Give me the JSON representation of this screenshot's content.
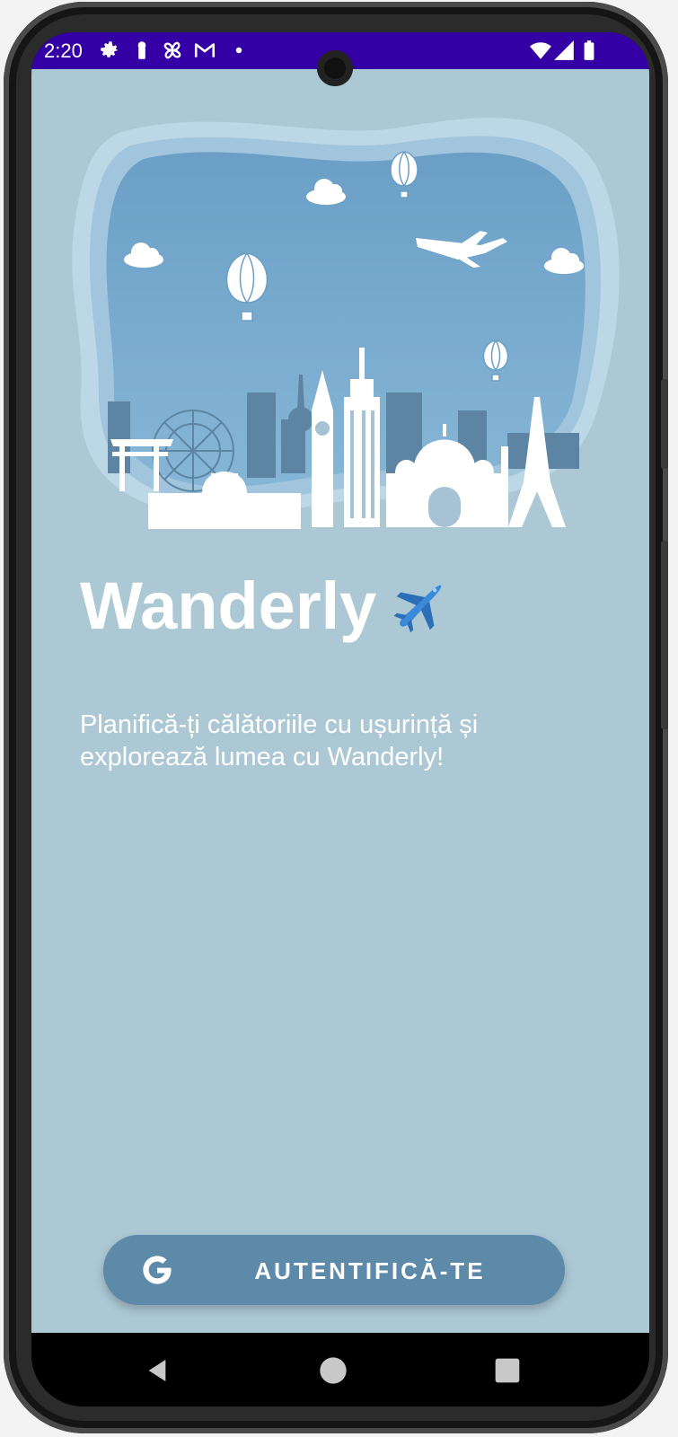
{
  "status_bar": {
    "time": "2:20",
    "left_icons": [
      "settings-icon",
      "keyhole-icon",
      "pinwheel-icon",
      "gmail-icon",
      "dot-icon"
    ],
    "right_icons": [
      "wifi-icon",
      "signal-icon",
      "battery-icon"
    ],
    "background": "#3400a6"
  },
  "app": {
    "background": "#acc8d5",
    "hero_illustration": "city-skyline-balloons-illustration",
    "title": "Wanderly",
    "title_emoji_icon": "airplane-icon",
    "subtitle": "Planifică-ți călătoriile cu ușurință și explorează lumea cu Wanderly!",
    "login_button": {
      "label": "AUTENTIFICĂ-TE",
      "icon": "google-icon",
      "color": "#5e8aaa"
    }
  },
  "nav_bar": {
    "buttons": [
      "back-icon",
      "home-icon",
      "recents-icon"
    ]
  }
}
